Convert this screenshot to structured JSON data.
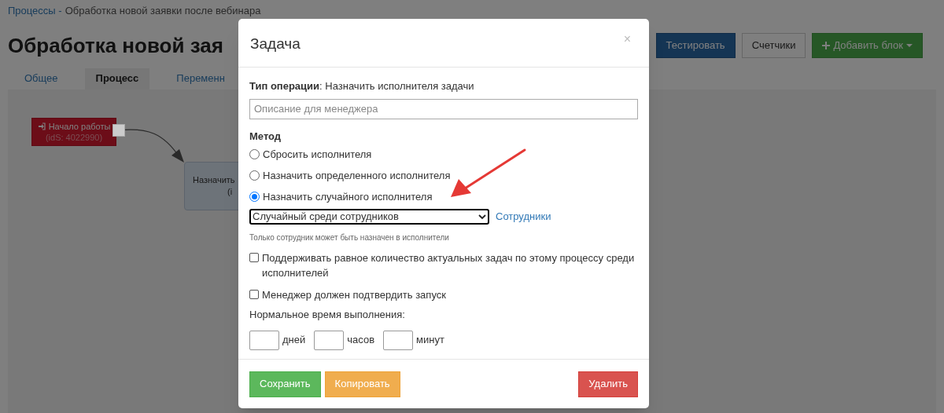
{
  "breadcrumb": [
    {
      "kind": "link",
      "text": "Процессы -"
    },
    {
      "kind": "text",
      "text": "Обработка новой заявки после вебинара"
    }
  ],
  "page_title": "Обработка новой зая",
  "header_buttons": [
    {
      "kind": "primary",
      "label": "Тестировать"
    },
    {
      "kind": "default",
      "label": "Счетчики"
    },
    {
      "kind": "add",
      "label": "Добавить блок"
    }
  ],
  "tabs": [
    {
      "label": "Общее",
      "selected": false
    },
    {
      "label": "Процесс",
      "selected": true
    },
    {
      "label": "Переменн",
      "selected": false
    }
  ],
  "canvas": {
    "nodes": [
      {
        "kind": "start",
        "label": "Начало работы",
        "id_text": "(idS: 4022990)"
      },
      {
        "kind": "task",
        "label": "Назначить",
        "id_text": "(i"
      }
    ]
  },
  "modal": {
    "title": "Задача",
    "close": "×",
    "operation": "**Тип операции**: Назначить исполнителя задачи",
    "description_field": {
      "placeholder": "Описание для менеджера"
    },
    "method_label": "Метод",
    "methods": [
      {
        "label": "Сбросить исполнителя",
        "selected": false
      },
      {
        "label": "Назначить определенного исполнителя",
        "selected": false
      },
      {
        "label": "Назначить случайного исполнителя",
        "selected": true
      }
    ],
    "select": {
      "value": "Случайный среди сотрудников",
      "link": "Сотрудники"
    },
    "hint": "Только сотрудник может быть назначен в исполнители",
    "checkboxes": [
      {
        "label": "Поддерживать равное количество актуальных задач по этому процессу среди исполнителей",
        "checked": false
      },
      {
        "label": "Менеджер должен подтвердить запуск",
        "checked": false
      }
    ],
    "time_label": "Нормальное время выполнения:",
    "time_fields": [
      {
        "unit": "дней"
      },
      {
        "unit": "часов"
      },
      {
        "unit": "минут"
      }
    ],
    "buttons": [
      {
        "kind": "save",
        "label": "Сохранить"
      },
      {
        "kind": "copy",
        "label": "Копировать"
      },
      {
        "kind": "delete",
        "label": "Удалить"
      }
    ]
  }
}
